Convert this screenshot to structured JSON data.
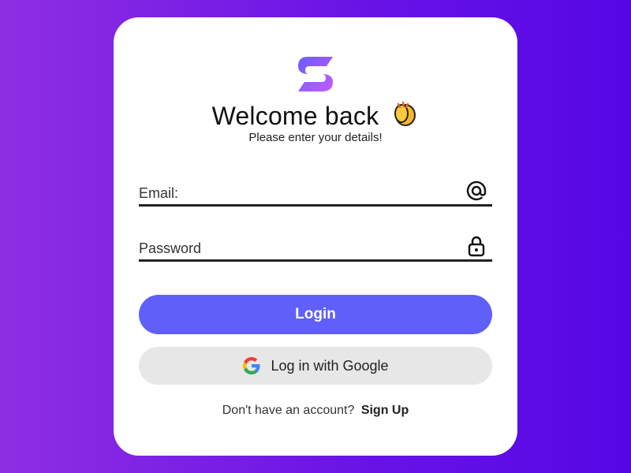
{
  "brand": {
    "logo_icon": "brand-s-logo-icon"
  },
  "header": {
    "title": "Welcome back",
    "emoji": "clapping-hands-icon",
    "subtitle": "Please enter your details!"
  },
  "form": {
    "email": {
      "placeholder": "Email:",
      "value": "",
      "icon": "at-sign-icon"
    },
    "password": {
      "placeholder": "Password",
      "value": "",
      "icon": "lock-icon"
    },
    "login_label": "Login",
    "google_label": "Log in with Google",
    "google_icon": "google-icon"
  },
  "footer": {
    "prompt": "Don't have an account?",
    "signup_label": "Sign Up"
  },
  "colors": {
    "bg_start": "#8f2ee3",
    "bg_end": "#5606e6",
    "primary": "#5f5ff9",
    "secondary_btn": "#e7e7e7"
  }
}
